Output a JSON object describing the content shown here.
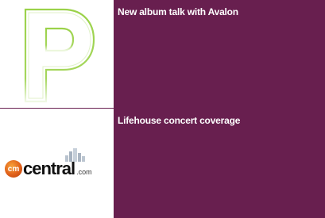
{
  "items": [
    {
      "title": "New album talk with Avalon",
      "thumbnail_icon": "p-letter-logo-icon"
    },
    {
      "title": "Lifehouse concert coverage",
      "thumbnail_icon": "cmcentral-logo-icon",
      "logo": {
        "badge_text": "cm",
        "word_text": "central",
        "suffix_text": ".com"
      }
    }
  ],
  "colors": {
    "panel": "#681f4f",
    "logo_green": "#9bd24a",
    "text": "#ffffff"
  }
}
